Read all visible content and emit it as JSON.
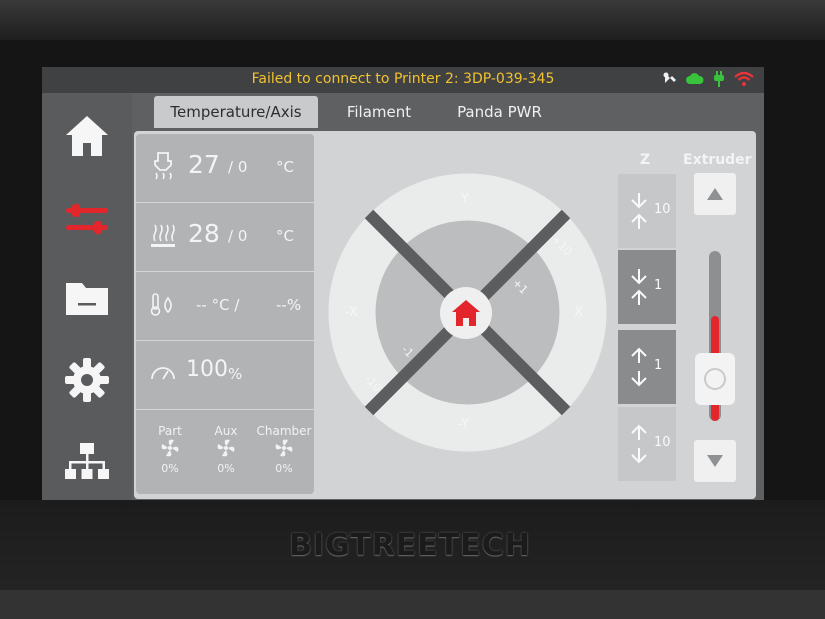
{
  "device": {
    "brand": "BIGTREETECH"
  },
  "status_bar": {
    "message": "Failed to connect to Printer 2: 3DP-039-345",
    "message_color": "#f2c230",
    "icons": [
      "wrench-icon",
      "cloud-icon",
      "plug-icon",
      "wifi-icon"
    ]
  },
  "sidebar": {
    "items": [
      {
        "name": "home",
        "icon": "home-icon",
        "active": false
      },
      {
        "name": "control",
        "icon": "sliders-icon",
        "active": true
      },
      {
        "name": "files",
        "icon": "folder-icon",
        "active": false
      },
      {
        "name": "settings",
        "icon": "gear-icon",
        "active": false
      },
      {
        "name": "network",
        "icon": "network-icon",
        "active": false
      }
    ]
  },
  "tabs": [
    {
      "label": "Temperature/Axis",
      "active": true
    },
    {
      "label": "Filament",
      "active": false
    },
    {
      "label": "Panda PWR",
      "active": false
    }
  ],
  "temps": {
    "nozzle": {
      "current": "27",
      "target": "/ 0",
      "unit": "°C"
    },
    "bed": {
      "current": "28",
      "target": "/ 0",
      "unit": "°C"
    },
    "chamber": {
      "temp": "-- °C /",
      "humidity": "--%"
    },
    "speed": {
      "value": "100",
      "unit": "%"
    }
  },
  "fans": [
    {
      "label": "Part",
      "value": "0%"
    },
    {
      "label": "Aux",
      "value": "0%"
    },
    {
      "label": "Chamber",
      "value": "0%"
    }
  ],
  "jog": {
    "y_plus": "Y",
    "y_minus": "-Y",
    "x_plus": "X",
    "x_minus": "-X",
    "plus10": "+10",
    "plus1": "+1",
    "minus1": "-1",
    "minus10": "-10"
  },
  "z_axis": {
    "header": "Z",
    "buttons": [
      {
        "amount": "10",
        "direction": "up"
      },
      {
        "amount": "1",
        "direction": "up"
      },
      {
        "amount": "1",
        "direction": "down"
      },
      {
        "amount": "10",
        "direction": "down"
      }
    ]
  },
  "extruder": {
    "header": "Extruder",
    "level": 0.62
  },
  "colors": {
    "accent": "#e3262c",
    "panel": "#d2d3d4",
    "card": "#b2b3b5"
  }
}
